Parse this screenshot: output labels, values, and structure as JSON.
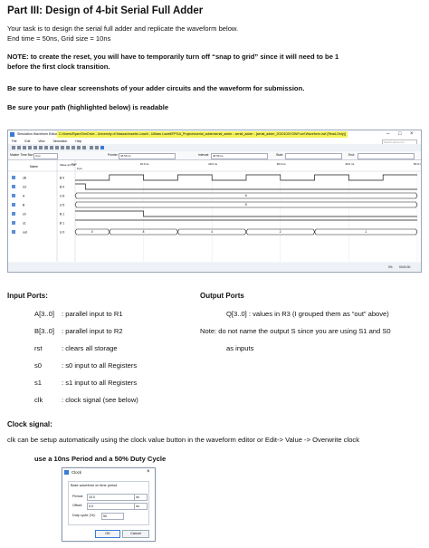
{
  "title": "Part III: Design of 4-bit Serial Full Adder",
  "intro": {
    "line1": "Your task is to design the serial full adder and replicate the waveform below.",
    "line2": "End time = 50ns, Grid size = 10ns"
  },
  "note": {
    "line1": "NOTE: to create the reset, you will have to temporarily turn off “snap to grid” since it will need to be 1",
    "line2": "before the first clock transition."
  },
  "screenshots_note": "Be sure to have clear screenshots of your adder circuits and the waveform for submission.",
  "path_note": "Be sure your path (highlighted below) is readable",
  "waveform_window": {
    "title": "Simulation Waveform Editor",
    "path": "C:/Users/Ryan/OneDrive - University of Massachusetts Lowell - UMass Lowell/FPGA_Projects/serial_adder/serial_adder - serial_adder - [serial_adder_20201029 DWF.vwf.Waveform.vwf (Read-Only)]",
    "menu": [
      "File",
      "Edit",
      "View",
      "Simulation",
      "Help"
    ],
    "search_placeholder": "Search altera.com",
    "master_time_bar_label": "Master Time Bar:",
    "master_time_bar_value": "0 ps",
    "pointer_label": "Pointer:",
    "pointer_value": "46.56 ns",
    "interval_label": "Interval:",
    "interval_value": "46.56 ns",
    "start_label": "Start:",
    "end_label": "End:",
    "col_name": "Name",
    "col_value": "Value at 0 ps",
    "time_ticks": [
      "0 ps",
      "10.0 ns",
      "20.0 ns",
      "30.0 ns",
      "40.0 ns",
      "50.0 ns"
    ],
    "zero_marker": "0 ps",
    "signals": [
      {
        "name": "clk",
        "value": "B 0"
      },
      {
        "name": "rst",
        "value": "B 0"
      },
      {
        "name": "A",
        "value": "U 6"
      },
      {
        "name": "B",
        "value": "U 5"
      },
      {
        "name": "s0",
        "value": "B 1"
      },
      {
        "name": "s1",
        "value": "B 1"
      },
      {
        "name": "out",
        "value": "U 0"
      }
    ],
    "bus_labels": {
      "A": "6",
      "B": "5",
      "out": [
        "0",
        "8",
        "4",
        "2",
        "1"
      ]
    },
    "status_zoom": "0%",
    "status_time": "00:00:00"
  },
  "input_ports": {
    "heading": "Input Ports:",
    "rows": [
      {
        "name": "A[3..0]",
        "desc": ": parallel input to R1"
      },
      {
        "name": "B[3..0]",
        "desc": ": parallel input to R2"
      },
      {
        "name": "rst",
        "desc": ": clears all storage"
      },
      {
        "name": "s0",
        "desc": ": s0 input to all Registers"
      },
      {
        "name": "s1",
        "desc": ": s1 input to all Registers"
      },
      {
        "name": "clk",
        "desc": ": clock signal (see below)"
      }
    ]
  },
  "output_ports": {
    "heading": "Output Ports",
    "line1": "Q[3..0] : values in R3 (I grouped them as “out” above)",
    "line2": "Note: do not name the output S since you are using S1 and S0",
    "line3": "as inputs"
  },
  "clock_signal": {
    "heading": "Clock signal:",
    "text": "clk can be setup automatically using the clock value button in the waveform editor or Edit-> Value -> Overwrite clock",
    "period_note": "use a 10ns Period and a 50% Duty Cycle"
  },
  "clock_dialog": {
    "title": "Clock",
    "group": "Base waveform on time period",
    "period_label": "Period:",
    "period_value": "10.0",
    "period_unit": "ns",
    "offset_label": "Offset:",
    "offset_value": "0.0",
    "offset_unit": "ns",
    "duty_label": "Duty cycle (%):",
    "duty_value": "50",
    "ok": "OK",
    "cancel": "Cancel"
  },
  "colors": {
    "highlight": "#f3f35a",
    "wave": "#1a1a1a",
    "bus_fill": "#ffffff",
    "accent": "#3a7bd5"
  }
}
